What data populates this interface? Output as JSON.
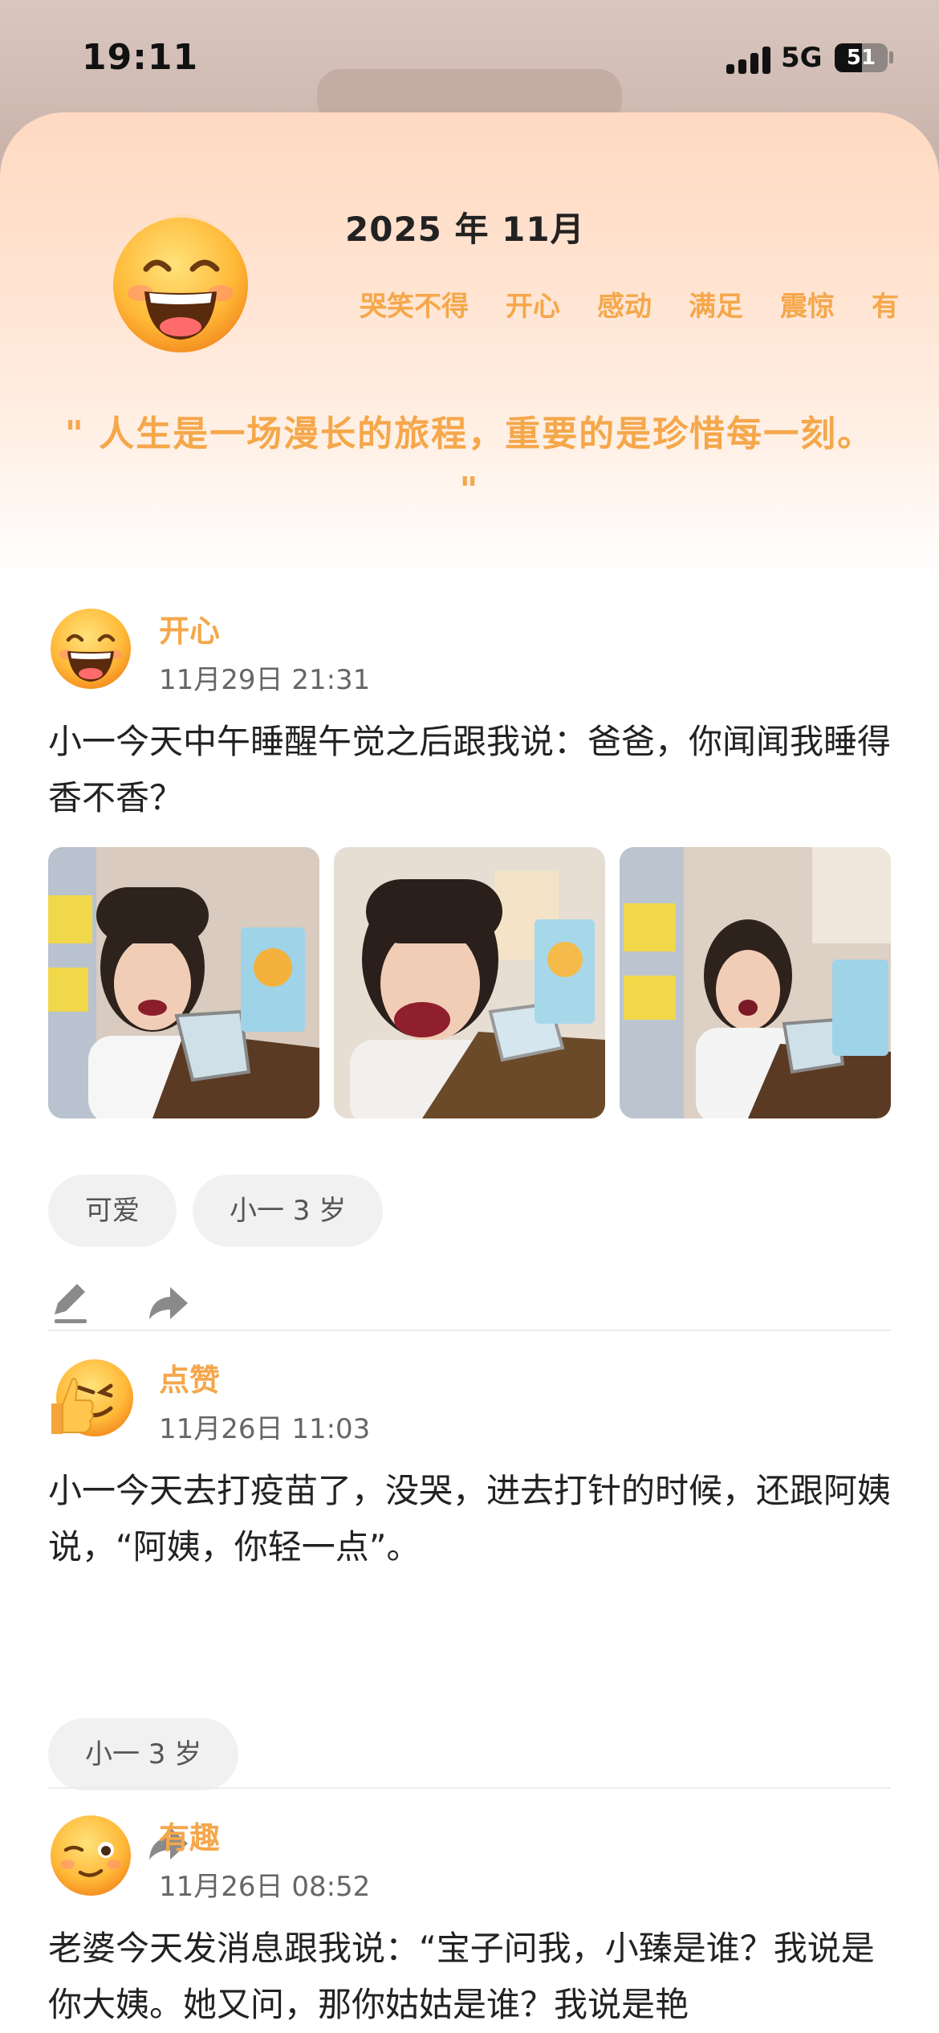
{
  "status_bar": {
    "time": "19:11",
    "network": "5G",
    "battery": "51",
    "battery_level": 0.51
  },
  "header": {
    "month": "2025 年 11月",
    "mood_tabs": [
      "哭笑不得",
      "开心",
      "感动",
      "满足",
      "震惊",
      "有"
    ],
    "quote": "\" 人生是一场漫长的旅程，重要的是珍惜每一刻。 \""
  },
  "posts": [
    {
      "mood": "开心",
      "date": "11月29日 21:31",
      "text": "小一今天中午睡醒午觉之后跟我说：爸爸，你闻闻我睡得香不香？",
      "tags": [
        "可爱",
        "小一 3 岁"
      ]
    },
    {
      "mood": "点赞",
      "date": "11月26日 11:03",
      "text": "小一今天去打疫苗了，没哭，进去打针的时候，还跟阿姨说，“阿姨，你轻一点”。",
      "tags": [
        "小一 3 岁"
      ]
    },
    {
      "mood": "有趣",
      "date": "11月26日 08:52",
      "text": "老婆今天发消息跟我说：“宝子问我，小臻是谁？我说是你大姨。她又问，那你姑姑是谁？我说是艳",
      "tags": []
    }
  ],
  "colors": {
    "accent": "#f5a74a",
    "header_gradient_top": "#ffd9c1"
  }
}
